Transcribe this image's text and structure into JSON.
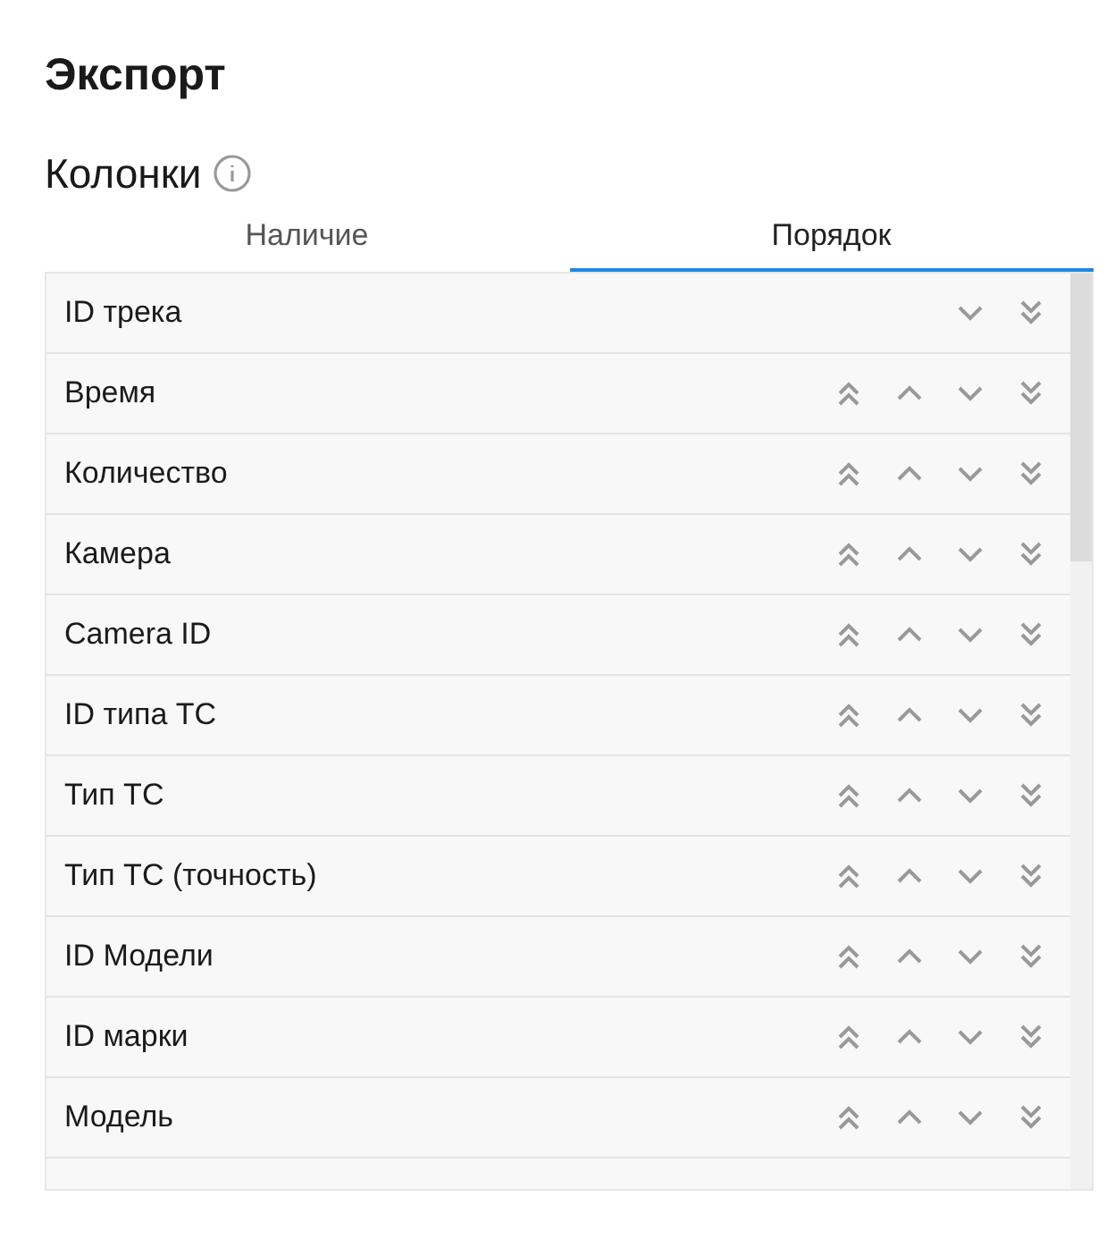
{
  "title": "Экспорт",
  "section": {
    "title": "Колонки"
  },
  "tabs": [
    {
      "label": "Наличие",
      "selected": false
    },
    {
      "label": "Порядок",
      "selected": true
    }
  ],
  "rows": [
    {
      "name": "ID трека",
      "can_move_up": false
    },
    {
      "name": "Время",
      "can_move_up": true
    },
    {
      "name": "Количество",
      "can_move_up": true
    },
    {
      "name": "Камера",
      "can_move_up": true
    },
    {
      "name": "Camera ID",
      "can_move_up": true
    },
    {
      "name": "ID типа ТС",
      "can_move_up": true
    },
    {
      "name": "Тип ТС",
      "can_move_up": true
    },
    {
      "name": "Тип ТС (точность)",
      "can_move_up": true
    },
    {
      "name": "ID Модели",
      "can_move_up": true
    },
    {
      "name": "ID марки",
      "can_move_up": true
    },
    {
      "name": "Модель",
      "can_move_up": true
    }
  ]
}
